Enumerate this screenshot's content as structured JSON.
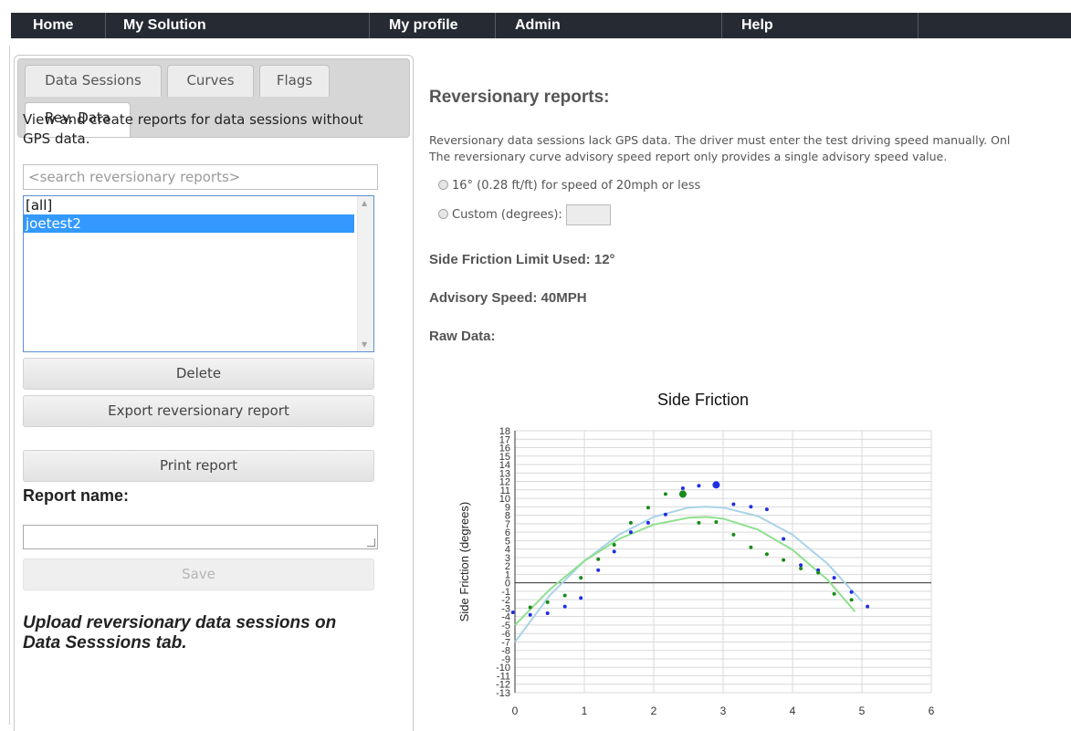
{
  "nav": {
    "items": [
      "Home",
      "My Solution",
      "My profile",
      "Admin",
      "Help"
    ]
  },
  "sidebar": {
    "tabs": [
      "Data Sessions",
      "Curves",
      "Flags",
      "Rev. Data"
    ],
    "active_tab": "Rev. Data",
    "description": "View and create reports for data sessions without GPS data.",
    "search_placeholder": "<search reversionary reports>",
    "reports": [
      {
        "label": "[all]",
        "selected": false
      },
      {
        "label": "joetest2",
        "selected": true
      }
    ],
    "buttons": {
      "delete": "Delete",
      "export": "Export reversionary report",
      "print": "Print report"
    },
    "report_name_label": "Report name:",
    "report_name_value": "",
    "save_label": "Save",
    "upload_note": "Upload reversionary data sessions on Data Sesssions tab."
  },
  "main": {
    "title": "Reversionary reports:",
    "desc_line1": "Reversionary data sessions lack GPS data. The driver must enter the test driving speed manually. Onl",
    "desc_line2": "The reversionary curve advisory speed report only provides a single advisory speed value.",
    "option1": "16° (0.28 ft/ft) for speed of 20mph or less",
    "option2": "Custom (degrees):",
    "side_friction": "Side Friction Limit Used: 12°",
    "advisory_speed": "Advisory Speed: 40MPH",
    "raw_data": "Raw Data:"
  },
  "chart_data": {
    "type": "scatter",
    "title": "Side Friction",
    "ylabel": "Side Friction (degrees)",
    "xlabel": "",
    "xlim": [
      0,
      6
    ],
    "ylim": [
      -13,
      18
    ],
    "x_ticks": [
      "0",
      "1",
      "2",
      "3",
      "4",
      "5",
      "6"
    ],
    "y_ticks": [
      "-13",
      "-12",
      "-11",
      "-10",
      "-9",
      "-8",
      "-7",
      "-6",
      "-5",
      "-4",
      "-3",
      "-2",
      "-1",
      "0",
      "1",
      "2",
      "3",
      "4",
      "5",
      "6",
      "7",
      "8",
      "9",
      "10",
      "11",
      "12",
      "13",
      "14",
      "15",
      "16",
      "17",
      "18"
    ],
    "grid": true,
    "series": [
      {
        "color": "#1f2ee6",
        "points": [
          [
            -0.03,
            -3.5
          ],
          [
            0.22,
            -3.8
          ],
          [
            0.47,
            -3.6
          ],
          [
            0.72,
            -2.8
          ],
          [
            0.95,
            -1.8
          ],
          [
            1.2,
            1.5
          ],
          [
            1.43,
            3.7
          ],
          [
            1.67,
            6.0
          ],
          [
            1.92,
            7.1
          ],
          [
            2.17,
            8.1
          ],
          [
            2.42,
            11.2
          ],
          [
            2.65,
            11.5
          ],
          [
            2.9,
            11.6
          ],
          [
            3.15,
            9.3
          ],
          [
            3.4,
            9.0
          ],
          [
            3.63,
            8.7
          ],
          [
            3.87,
            5.2
          ],
          [
            4.12,
            2.1
          ],
          [
            4.37,
            1.5
          ],
          [
            4.6,
            0.6
          ],
          [
            4.85,
            -1.1
          ],
          [
            5.08,
            -2.8
          ]
        ],
        "sizes": [
          1,
          1,
          1,
          1,
          1,
          1,
          1,
          1,
          1,
          1,
          1,
          1,
          3,
          1,
          1,
          1,
          1,
          1,
          1,
          1,
          1,
          1
        ]
      },
      {
        "color": "#1a8a1a",
        "points": [
          [
            0.22,
            -2.9
          ],
          [
            0.47,
            -2.3
          ],
          [
            0.72,
            -1.5
          ],
          [
            0.95,
            0.6
          ],
          [
            1.2,
            2.8
          ],
          [
            1.43,
            4.5
          ],
          [
            1.67,
            7.1
          ],
          [
            1.92,
            8.9
          ],
          [
            2.17,
            10.5
          ],
          [
            2.42,
            10.5
          ],
          [
            2.65,
            7.1
          ],
          [
            2.9,
            7.2
          ],
          [
            3.15,
            5.7
          ],
          [
            3.4,
            4.2
          ],
          [
            3.63,
            3.4
          ],
          [
            3.87,
            2.7
          ],
          [
            4.12,
            1.7
          ],
          [
            4.37,
            1.2
          ],
          [
            4.6,
            -1.3
          ],
          [
            4.85,
            -2.0
          ]
        ],
        "sizes": [
          1,
          1,
          1,
          1,
          1,
          1,
          1,
          1,
          1,
          3,
          1,
          1,
          1,
          1,
          1,
          1,
          1,
          1,
          1,
          1
        ]
      }
    ],
    "fits": [
      {
        "color": "#a9d3e8",
        "points": [
          [
            0,
            -7
          ],
          [
            0.5,
            -1.5
          ],
          [
            1,
            2.6
          ],
          [
            1.5,
            5.7
          ],
          [
            2,
            7.8
          ],
          [
            2.5,
            8.9
          ],
          [
            2.75,
            9.0
          ],
          [
            3,
            8.9
          ],
          [
            3.5,
            7.9
          ],
          [
            4,
            5.7
          ],
          [
            4.5,
            2.3
          ],
          [
            5,
            -2.2
          ]
        ]
      },
      {
        "color": "#8fe08f",
        "points": [
          [
            0,
            -5
          ],
          [
            0.5,
            -0.8
          ],
          [
            1,
            2.6
          ],
          [
            1.5,
            5.2
          ],
          [
            2,
            6.9
          ],
          [
            2.5,
            7.7
          ],
          [
            2.75,
            7.8
          ],
          [
            3,
            7.6
          ],
          [
            3.5,
            6.3
          ],
          [
            4,
            3.9
          ],
          [
            4.5,
            0.4
          ],
          [
            4.9,
            -3.4
          ]
        ]
      }
    ]
  }
}
